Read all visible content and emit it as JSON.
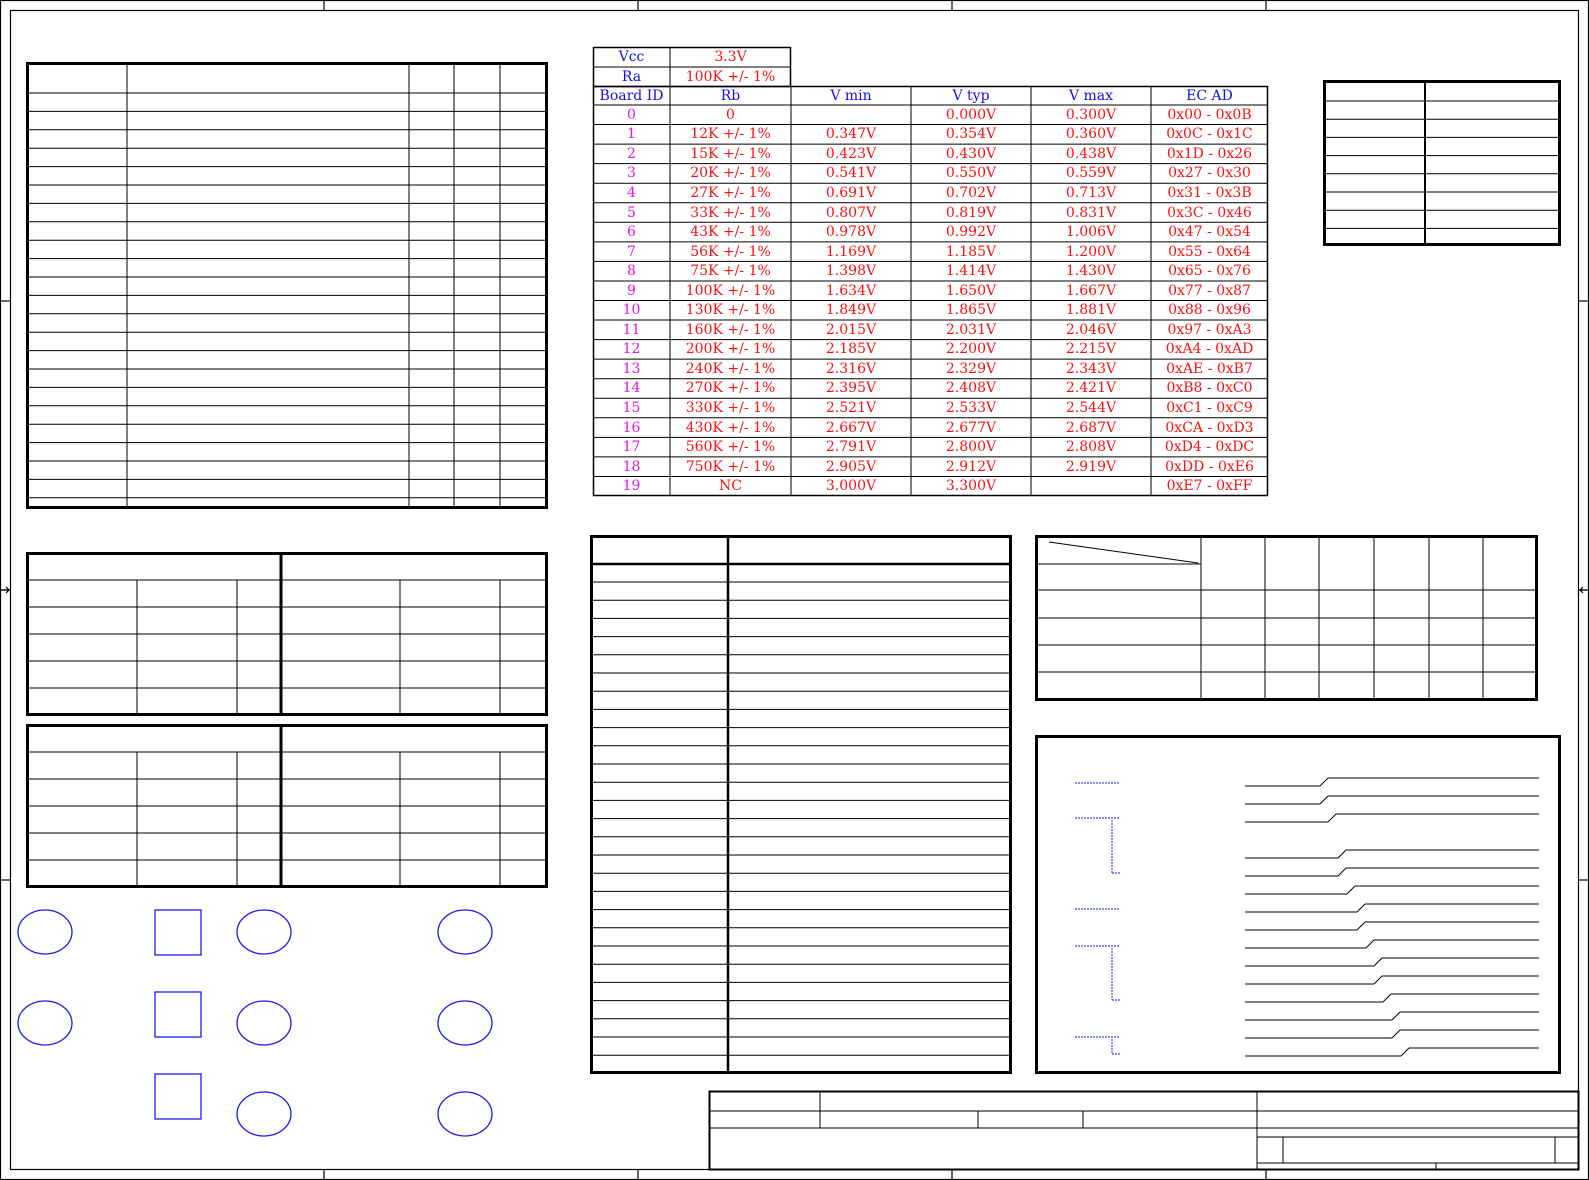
{
  "header": {
    "vcc_label": "Vcc",
    "vcc_value": "3.3V",
    "ra_label": "Ra",
    "ra_value": "100K +/- 1%"
  },
  "columns": [
    "Board ID",
    "Rb",
    "V min",
    "V typ",
    "V max",
    "EC AD"
  ],
  "rows": [
    {
      "id": "0",
      "rb": "0",
      "vmin": "",
      "vtyp": "0.000V",
      "vmax": "0.300V",
      "ad": "0x00 - 0x0B"
    },
    {
      "id": "1",
      "rb": "12K +/- 1%",
      "vmin": "0.347V",
      "vtyp": "0.354V",
      "vmax": "0.360V",
      "ad": "0x0C - 0x1C"
    },
    {
      "id": "2",
      "rb": "15K +/- 1%",
      "vmin": "0.423V",
      "vtyp": "0.430V",
      "vmax": "0.438V",
      "ad": "0x1D - 0x26"
    },
    {
      "id": "3",
      "rb": "20K +/- 1%",
      "vmin": "0.541V",
      "vtyp": "0.550V",
      "vmax": "0.559V",
      "ad": "0x27 - 0x30"
    },
    {
      "id": "4",
      "rb": "27K +/- 1%",
      "vmin": "0.691V",
      "vtyp": "0.702V",
      "vmax": "0.713V",
      "ad": "0x31 - 0x3B"
    },
    {
      "id": "5",
      "rb": "33K +/- 1%",
      "vmin": "0.807V",
      "vtyp": "0.819V",
      "vmax": "0.831V",
      "ad": "0x3C - 0x46"
    },
    {
      "id": "6",
      "rb": "43K +/- 1%",
      "vmin": "0.978V",
      "vtyp": "0.992V",
      "vmax": "1.006V",
      "ad": "0x47 - 0x54"
    },
    {
      "id": "7",
      "rb": "56K +/- 1%",
      "vmin": "1.169V",
      "vtyp": "1.185V",
      "vmax": "1.200V",
      "ad": "0x55 - 0x64"
    },
    {
      "id": "8",
      "rb": "75K +/- 1%",
      "vmin": "1.398V",
      "vtyp": "1.414V",
      "vmax": "1.430V",
      "ad": "0x65 - 0x76"
    },
    {
      "id": "9",
      "rb": "100K +/- 1%",
      "vmin": "1.634V",
      "vtyp": "1.650V",
      "vmax": "1.667V",
      "ad": "0x77 - 0x87"
    },
    {
      "id": "10",
      "rb": "130K +/- 1%",
      "vmin": "1.849V",
      "vtyp": "1.865V",
      "vmax": "1.881V",
      "ad": "0x88 - 0x96"
    },
    {
      "id": "11",
      "rb": "160K +/- 1%",
      "vmin": "2.015V",
      "vtyp": "2.031V",
      "vmax": "2.046V",
      "ad": "0x97 - 0xA3"
    },
    {
      "id": "12",
      "rb": "200K +/- 1%",
      "vmin": "2.185V",
      "vtyp": "2.200V",
      "vmax": "2.215V",
      "ad": "0xA4 - 0xAD"
    },
    {
      "id": "13",
      "rb": "240K +/- 1%",
      "vmin": "2.316V",
      "vtyp": "2.329V",
      "vmax": "2.343V",
      "ad": "0xAE - 0xB7"
    },
    {
      "id": "14",
      "rb": "270K +/- 1%",
      "vmin": "2.395V",
      "vtyp": "2.408V",
      "vmax": "2.421V",
      "ad": "0xB8 - 0xC0"
    },
    {
      "id": "15",
      "rb": "330K +/- 1%",
      "vmin": "2.521V",
      "vtyp": "2.533V",
      "vmax": "2.544V",
      "ad": "0xC1 - 0xC9"
    },
    {
      "id": "16",
      "rb": "430K +/- 1%",
      "vmin": "2.667V",
      "vtyp": "2.677V",
      "vmax": "2.687V",
      "ad": "0xCA - 0xD3"
    },
    {
      "id": "17",
      "rb": "560K +/- 1%",
      "vmin": "2.791V",
      "vtyp": "2.800V",
      "vmax": "2.808V",
      "ad": "0xD4 - 0xDC"
    },
    {
      "id": "18",
      "rb": "750K +/- 1%",
      "vmin": "2.905V",
      "vtyp": "2.912V",
      "vmax": "2.919V",
      "ad": "0xDD - 0xE6"
    },
    {
      "id": "19",
      "rb": "NC",
      "vmin": "3.000V",
      "vtyp": "3.300V",
      "vmax": "",
      "ad": "0xE7 - 0xFF"
    }
  ],
  "colors": {
    "frame": "#000000",
    "label_blue": "#1010ee",
    "id_magenta": "#ee10ee",
    "value_red": "#ff1010",
    "shape_blue": "#1a1aee"
  },
  "icons": [
    "ellipse-icon",
    "square-icon"
  ]
}
